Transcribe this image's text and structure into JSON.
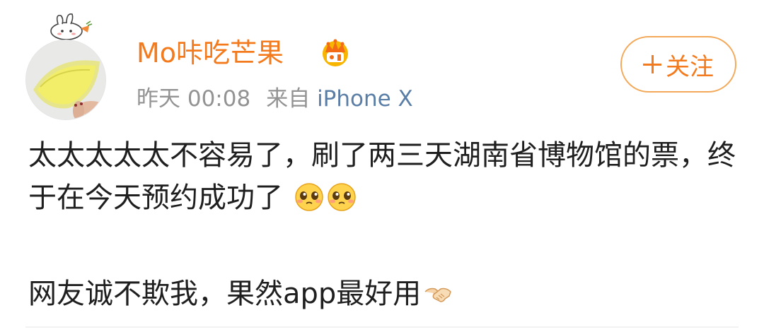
{
  "user": {
    "name": "Mo咔吃芒果",
    "badge_icon": "crown-icon"
  },
  "meta": {
    "time": "昨天 00:08",
    "from_label": "来自",
    "device": "iPhone X"
  },
  "follow": {
    "label": "关注",
    "icon": "plus-icon"
  },
  "post": {
    "line1_text": "太太太太太不容易了，刷了两三天湖南省博物馆的票，终于在今天预约成功了",
    "line1_emojis": [
      "pleading-face-icon",
      "pleading-face-icon"
    ],
    "line2_text": "网友诚不欺我，果然app最好用",
    "line2_emojis": [
      "handshake-icon"
    ]
  },
  "colors": {
    "username": "#f37b1d",
    "follow_border": "#f4a95a",
    "meta": "#939393",
    "device": "#5b7ea6",
    "text": "#1f1f1f"
  }
}
